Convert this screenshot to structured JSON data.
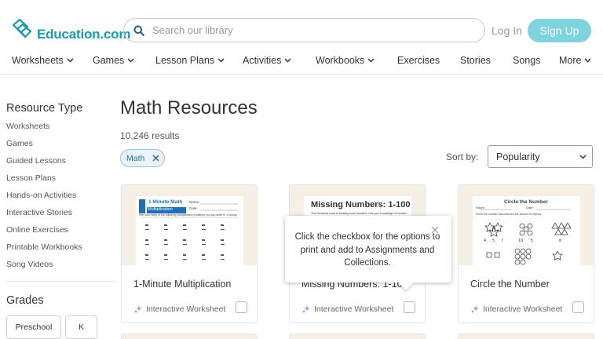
{
  "header": {
    "logo_text": "Education.com",
    "search_placeholder": "Search our library",
    "login_label": "Log In",
    "signup_label": "Sign Up"
  },
  "nav": {
    "items": [
      {
        "label": "Worksheets",
        "has_dropdown": true
      },
      {
        "label": "Games",
        "has_dropdown": true
      },
      {
        "label": "Lesson Plans",
        "has_dropdown": true
      },
      {
        "label": "Activities",
        "has_dropdown": true
      },
      {
        "label": "Workbooks",
        "has_dropdown": true
      },
      {
        "label": "Exercises",
        "has_dropdown": false
      },
      {
        "label": "Stories",
        "has_dropdown": false
      },
      {
        "label": "Songs",
        "has_dropdown": false
      },
      {
        "label": "More",
        "has_dropdown": true
      }
    ]
  },
  "sidebar": {
    "resource_type_title": "Resource Type",
    "resource_types": [
      "Worksheets",
      "Games",
      "Guided Lessons",
      "Lesson Plans",
      "Hands-on Activities",
      "Interactive Stories",
      "Online Exercises",
      "Printable Workbooks",
      "Song Videos"
    ],
    "grades_title": "Grades",
    "grades": [
      "Preschool",
      "K"
    ]
  },
  "main": {
    "title": "Math Resources",
    "results": "10,246 results",
    "filter_chip": "Math",
    "sort_label": "Sort by:",
    "sort_value": "Popularity"
  },
  "cards": [
    {
      "title": "1-Minute Multiplication",
      "type": "Interactive Worksheet",
      "thumb_heading": "1 Minute Math",
      "thumb_subheading": "Multiplication",
      "thumb_instructions": "See how many of the following multiplication problems you can solve in 1 minute.",
      "thumb_fields": [
        "Name:",
        "Date:"
      ]
    },
    {
      "title": "Missing Numbers: 1-100",
      "type": "Interactive Worksheet",
      "thumb_heading": "Missing Numbers: 1-100",
      "thumb_instructions": "This hundreds chart is missing some numbers. Use your knowledge of number..."
    },
    {
      "title": "Circle the Number",
      "type": "Interactive Worksheet",
      "thumb_heading": "Circle the Number",
      "thumb_fields": [
        "Name:",
        "Date:"
      ],
      "thumb_instructions": "Circle the number that matches the amount of objects.",
      "thumb_numbers": [
        "4",
        "5",
        "7",
        "10",
        "5",
        "8"
      ]
    }
  ],
  "tooltip": {
    "text": "Click the checkbox for the options to print and add to Assignments and Collections."
  },
  "colors": {
    "brand": "#1a9bb0",
    "signup_bg": "#7fd3df",
    "card_image_bg": "#f6efe6",
    "chip_bg": "#eaf3fb"
  }
}
